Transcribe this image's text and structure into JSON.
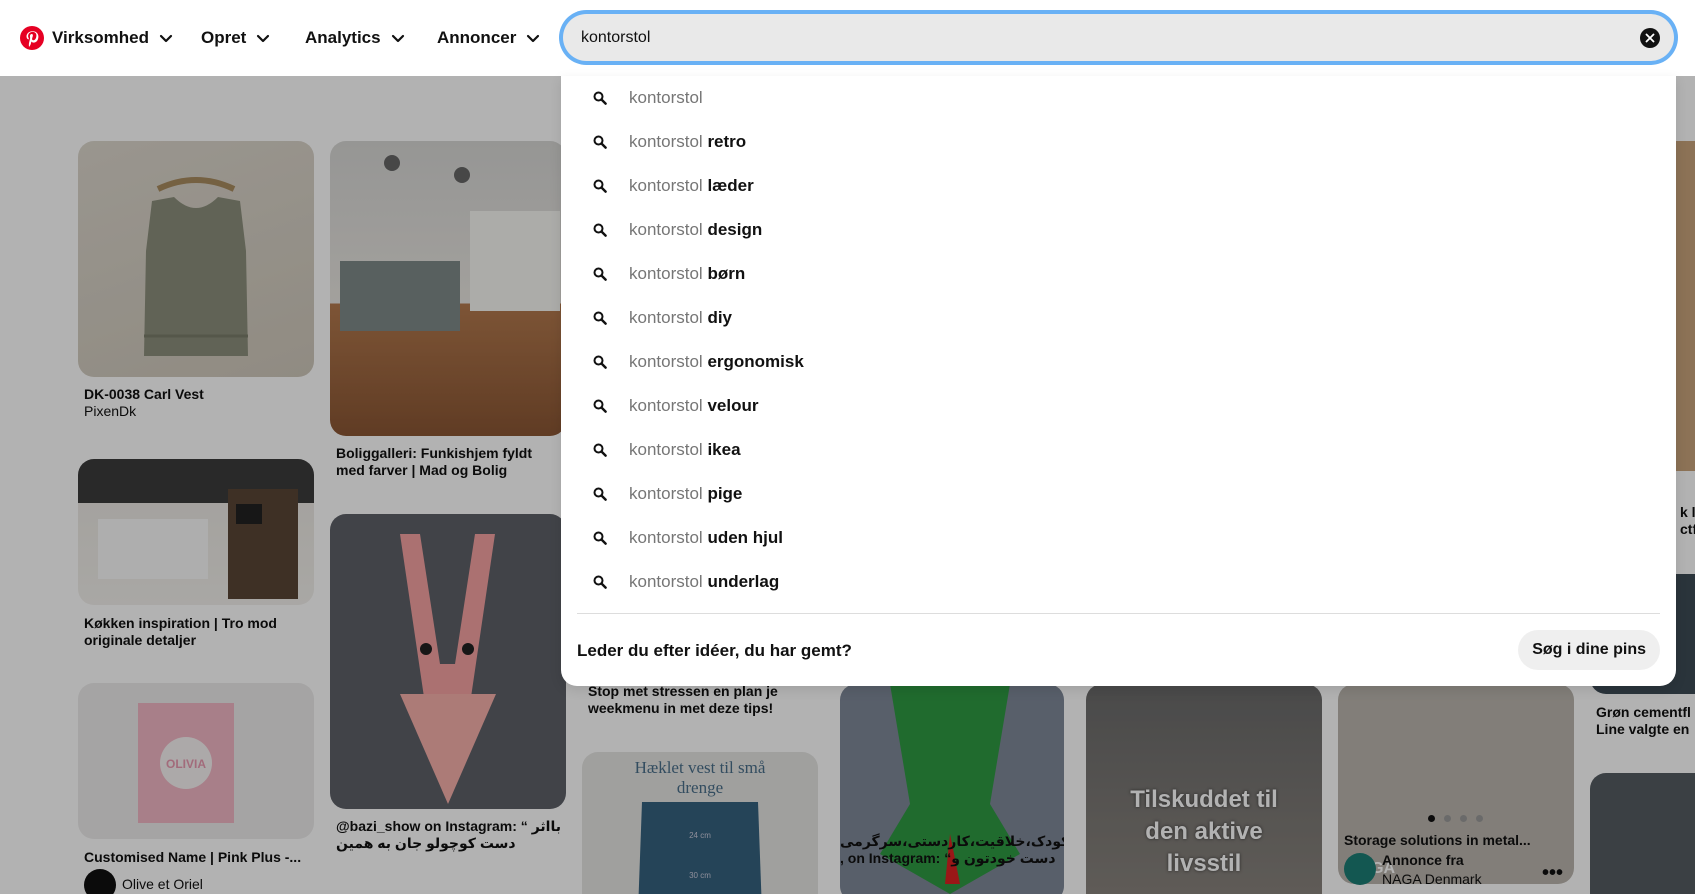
{
  "header": {
    "nav": [
      {
        "label": "Virksomhed"
      },
      {
        "label": "Opret"
      },
      {
        "label": "Analytics"
      },
      {
        "label": "Annoncer"
      }
    ],
    "search_value": "kontorstol"
  },
  "suggestions": {
    "base": "kontorstol",
    "items": [
      "",
      "retro",
      "læder",
      "design",
      "børn",
      "diy",
      "ergonomisk",
      "velour",
      "ikea",
      "pige",
      "uden hjul",
      "underlag"
    ],
    "saved_question": "Leder du efter idéer, du har gemt?",
    "saved_button": "Søg i dine pins"
  },
  "feed": {
    "pins": [
      {
        "title": "DK-0038 Carl Vest",
        "sub": "PixenDk"
      },
      {
        "title": "Køkken inspiration | Tro mod originale detaljer"
      },
      {
        "title": "Customised Name | Pink Plus -...",
        "sub": "Olive et Oriel"
      },
      {
        "title": "Boliggalleri: Funkishjem fyldt med farver | Mad og Bolig"
      },
      {
        "title": "@bazi_show on Instagram: “ بااثر دست کوچولو جان به همین راحتی خرگوش"
      },
      {
        "title": "Stop met stressen en plan je weekmenu in met deze tips!"
      },
      {
        "title": "Hæklet vest til små drenge"
      },
      {
        "title": "کودک،خلاقیت،کاردستی،سرگرمی , on Instagram: “دست خودتون و بچه ها رو”..."
      },
      {
        "title": "Tilskuddet til den aktive livsstil"
      },
      {
        "title": "Storage solutions in metal...",
        "ad_label": "Annonce fra",
        "advertiser": "NAGA Denmark",
        "brand": "NAGA"
      },
      {
        "title": "Grøn cementfl Line valgte en"
      },
      {
        "title": "k li ctfo"
      }
    ],
    "image_text": {
      "sweater_width_top": "24 cm",
      "sweater_width_bottom": "30 cm",
      "poster_name": "OLIVIA"
    }
  },
  "colors": {
    "brand": "#e60023",
    "focus_ring": "#0084ff"
  }
}
